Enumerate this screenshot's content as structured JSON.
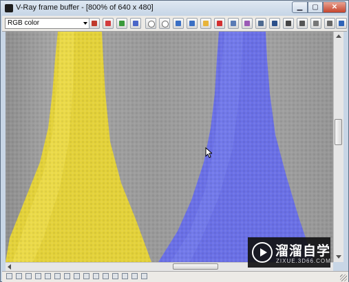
{
  "window": {
    "title": "V-Ray frame buffer - [800% of 640 x 480]",
    "minimize_icon": "minimize-icon",
    "maximize_icon": "maximize-icon",
    "close_icon": "close-icon"
  },
  "toolbar": {
    "channel_value": "RGB color",
    "buttons": [
      {
        "name": "color-mode-icon",
        "color": "#c0392b"
      },
      {
        "name": "red-channel-icon",
        "color": "#d33b3b"
      },
      {
        "name": "green-channel-icon",
        "color": "#3a9a3a"
      },
      {
        "name": "blue-channel-icon",
        "color": "#4a66c8"
      },
      {
        "name": "alpha-channel-icon",
        "color": "#ffffff"
      },
      {
        "name": "mono-channel-icon",
        "color": "#ffffff"
      },
      {
        "name": "save-icon",
        "color": "#3a6fc4"
      },
      {
        "name": "save-all-icon",
        "color": "#3a6fc4"
      },
      {
        "name": "load-icon",
        "color": "#e8b43a"
      },
      {
        "name": "clear-icon",
        "color": "#d32f2f"
      },
      {
        "name": "duplicate-icon",
        "color": "#5a7bb5"
      },
      {
        "name": "track-mouse-icon",
        "color": "#9b59b6"
      },
      {
        "name": "copy-icon",
        "color": "#4f6a8f"
      },
      {
        "name": "vfb-settings-icon",
        "color": "#2b4f8a"
      },
      {
        "name": "region-render-icon",
        "color": "#444444"
      },
      {
        "name": "link-icon",
        "color": "#555555"
      },
      {
        "name": "stop-render-icon",
        "color": "#777777"
      },
      {
        "name": "lut-icon",
        "color": "#666666"
      },
      {
        "name": "render-icon",
        "color": "#2f64b8"
      }
    ]
  },
  "status_icons": [
    "zoom-icon",
    "pixel-info-icon",
    "info-icon",
    "history-icon",
    "correction-icon",
    "color-correction-icon",
    "levels-icon",
    "curve-icon",
    "exposure-icon",
    "lens-icon",
    "srgb-icon",
    "compare-icon",
    "vertical-split-icon",
    "horizontal-split-icon",
    "display-icon"
  ],
  "watermark": {
    "main": "溜溜自学",
    "sub": "ZIXUE.3D66.COM"
  },
  "colors": {
    "background": "#9a9a9a",
    "yellow_vase": "#e4d23a",
    "blue_vase": "#6b72e8"
  }
}
